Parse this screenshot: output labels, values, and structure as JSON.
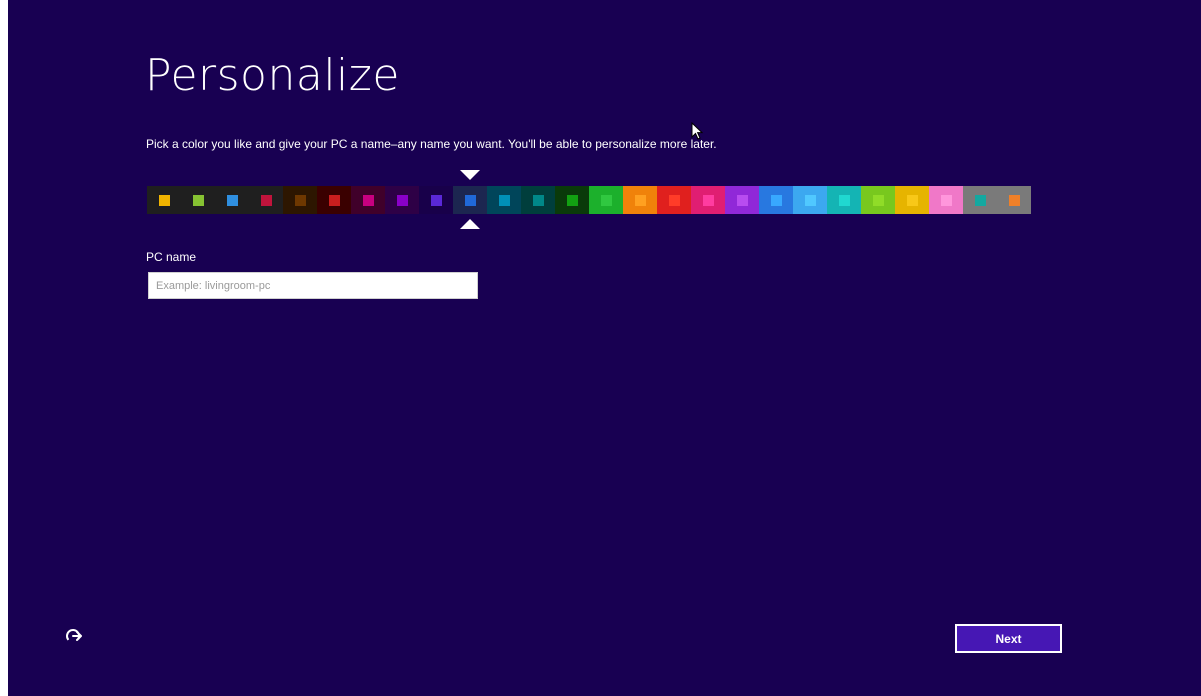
{
  "window": {
    "background": "#180052"
  },
  "header": {
    "title": "Personalize",
    "subtitle": "Pick a color you like and give your PC a name–any name you want. You'll be able to personalize more later."
  },
  "palette": {
    "selected_index": 9,
    "swatches": [
      {
        "bg": "#1f1f1f",
        "fg": "#f0b400"
      },
      {
        "bg": "#1f1f1f",
        "fg": "#86c232"
      },
      {
        "bg": "#1f1f1f",
        "fg": "#2f8fe0"
      },
      {
        "bg": "#1f1f1f",
        "fg": "#c0143c"
      },
      {
        "bg": "#2d1600",
        "fg": "#6e3800"
      },
      {
        "bg": "#3a0000",
        "fg": "#c81e1e"
      },
      {
        "bg": "#40002a",
        "fg": "#c80080"
      },
      {
        "bg": "#2e0046",
        "fg": "#8a00c8"
      },
      {
        "bg": "#18004a",
        "fg": "#5a28d8"
      },
      {
        "bg": "#1c2650",
        "fg": "#2068d8"
      },
      {
        "bg": "#00455a",
        "fg": "#0090b8"
      },
      {
        "bg": "#003e3c",
        "fg": "#008888"
      },
      {
        "bg": "#0a3a0a",
        "fg": "#12a012"
      },
      {
        "bg": "#1cb02c",
        "fg": "#30c840"
      },
      {
        "bg": "#f0820a",
        "fg": "#ffa020"
      },
      {
        "bg": "#e0201e",
        "fg": "#ff3c28"
      },
      {
        "bg": "#e01e72",
        "fg": "#ff3ca0"
      },
      {
        "bg": "#9028d8",
        "fg": "#b84cf0"
      },
      {
        "bg": "#2878e0",
        "fg": "#38a8ff"
      },
      {
        "bg": "#3ca8f0",
        "fg": "#50c8ff"
      },
      {
        "bg": "#14b4b4",
        "fg": "#20d8d0"
      },
      {
        "bg": "#78c81e",
        "fg": "#90dc28"
      },
      {
        "bg": "#e6b400",
        "fg": "#f8c818"
      },
      {
        "bg": "#f078c8",
        "fg": "#ff96dc"
      },
      {
        "bg": "#7a7a7a",
        "fg": "#14a8a0"
      },
      {
        "bg": "#7a7a7a",
        "fg": "#f08028"
      }
    ]
  },
  "pc_name": {
    "label": "PC name",
    "placeholder": "Example: livingroom-pc",
    "value": ""
  },
  "footer": {
    "ease_of_access_icon": "ease-of-access-icon",
    "next_label": "Next"
  },
  "cursor_icon": "mouse-pointer-icon"
}
